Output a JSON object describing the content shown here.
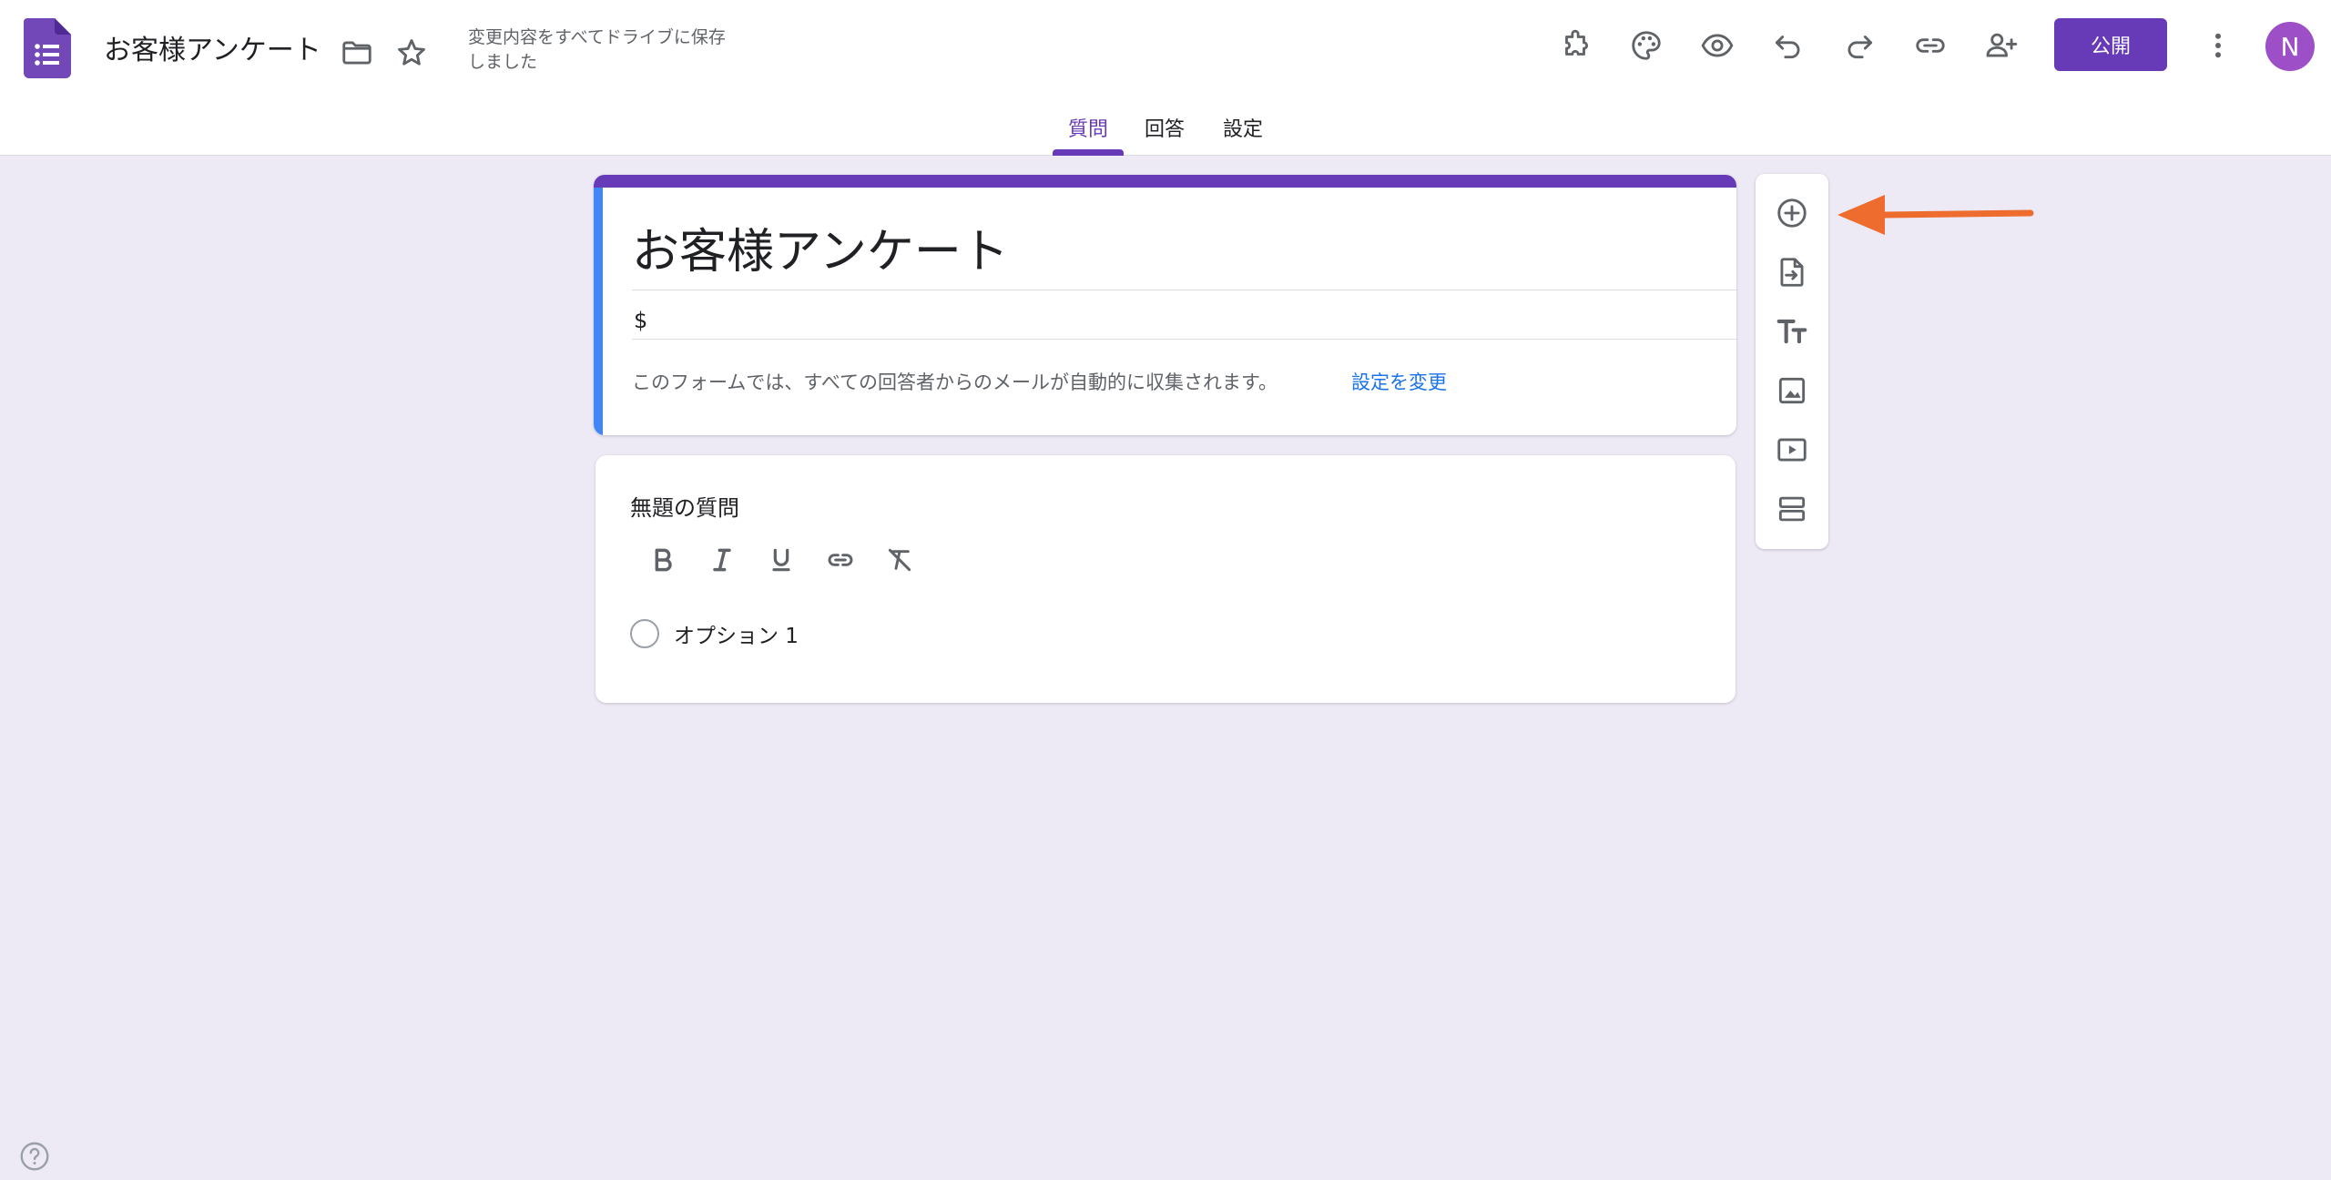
{
  "app": {
    "title": "お客様アンケート",
    "save_status": "変更内容をすべてドライブに保存しました",
    "brand_color": "#673ab7",
    "accent_blue": "#4285f4"
  },
  "header": {
    "icons": [
      "folder-icon",
      "star-icon",
      "addon-icon",
      "palette-icon",
      "preview-icon",
      "undo-icon",
      "redo-icon",
      "link-icon",
      "add-collaborator-icon",
      "more-vert-icon"
    ],
    "publish_label": "公開",
    "avatar_initial": "N"
  },
  "tabs": [
    {
      "label": "質問",
      "active": true
    },
    {
      "label": "回答",
      "active": false
    },
    {
      "label": "設定",
      "active": false
    }
  ],
  "form": {
    "title": "お客様アンケート",
    "description": "$",
    "email_notice": "このフォームでは、すべての回答者からのメールが自動的に収集されます。",
    "settings_link": "設定を変更"
  },
  "question": {
    "title": "無題の質問",
    "format_tools": [
      "bold-icon",
      "italic-icon",
      "underline-icon",
      "link-icon",
      "clear-format-icon"
    ],
    "options": [
      {
        "label": "オプション 1"
      }
    ]
  },
  "side_toolbar": {
    "tools": [
      "add-question-icon",
      "import-questions-icon",
      "add-title-icon",
      "add-image-icon",
      "add-video-icon",
      "add-section-icon"
    ]
  },
  "annotation": {
    "arrow_color": "#ee6c2d"
  }
}
